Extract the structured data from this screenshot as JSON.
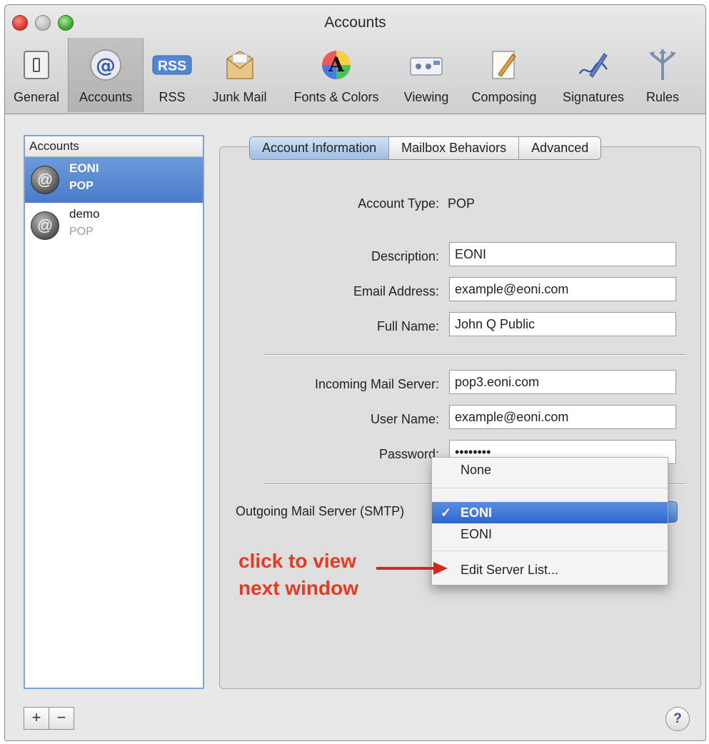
{
  "window": {
    "title": "Accounts"
  },
  "toolbar": {
    "items": [
      {
        "label": "General",
        "icon": "general-switch-icon"
      },
      {
        "label": "Accounts",
        "icon": "at-sign-icon"
      },
      {
        "label": "RSS",
        "icon": "rss-icon"
      },
      {
        "label": "Junk Mail",
        "icon": "junk-mail-icon"
      },
      {
        "label": "Fonts & Colors",
        "icon": "fonts-colors-icon"
      },
      {
        "label": "Viewing",
        "icon": "viewing-icon"
      },
      {
        "label": "Composing",
        "icon": "composing-icon"
      },
      {
        "label": "Signatures",
        "icon": "signatures-icon"
      },
      {
        "label": "Rules",
        "icon": "rules-icon"
      }
    ],
    "selected": "Accounts"
  },
  "accounts": {
    "header": "Accounts",
    "items": [
      {
        "name": "EONI",
        "type": "POP",
        "selected": true
      },
      {
        "name": "demo",
        "type": "POP",
        "selected": false
      }
    ],
    "add_label": "+",
    "remove_label": "−"
  },
  "tabs": {
    "items": [
      "Account Information",
      "Mailbox Behaviors",
      "Advanced"
    ],
    "selected": "Account Information"
  },
  "form": {
    "account_type_label": "Account Type:",
    "account_type_value": "POP",
    "description_label": "Description:",
    "description_value": "EONI",
    "email_label": "Email Address:",
    "email_value": "example@eoni.com",
    "fullname_label": "Full Name:",
    "fullname_value": "John Q Public",
    "incoming_label": "Incoming Mail Server:",
    "incoming_value": "pop3.eoni.com",
    "username_label": "User Name:",
    "username_value": "example@eoni.com",
    "password_label": "Password:",
    "password_value": "••••••••",
    "smtp_label": "Outgoing Mail Server (SMTP)"
  },
  "smtp_menu": {
    "items": [
      "None",
      "EONI",
      "EONI",
      "Edit Server List..."
    ],
    "selected_index": 1,
    "check_mark": "✓"
  },
  "annotation": {
    "line1": "click to view",
    "line2": "next window",
    "color": "#e43a22"
  },
  "help": {
    "label": "?"
  }
}
